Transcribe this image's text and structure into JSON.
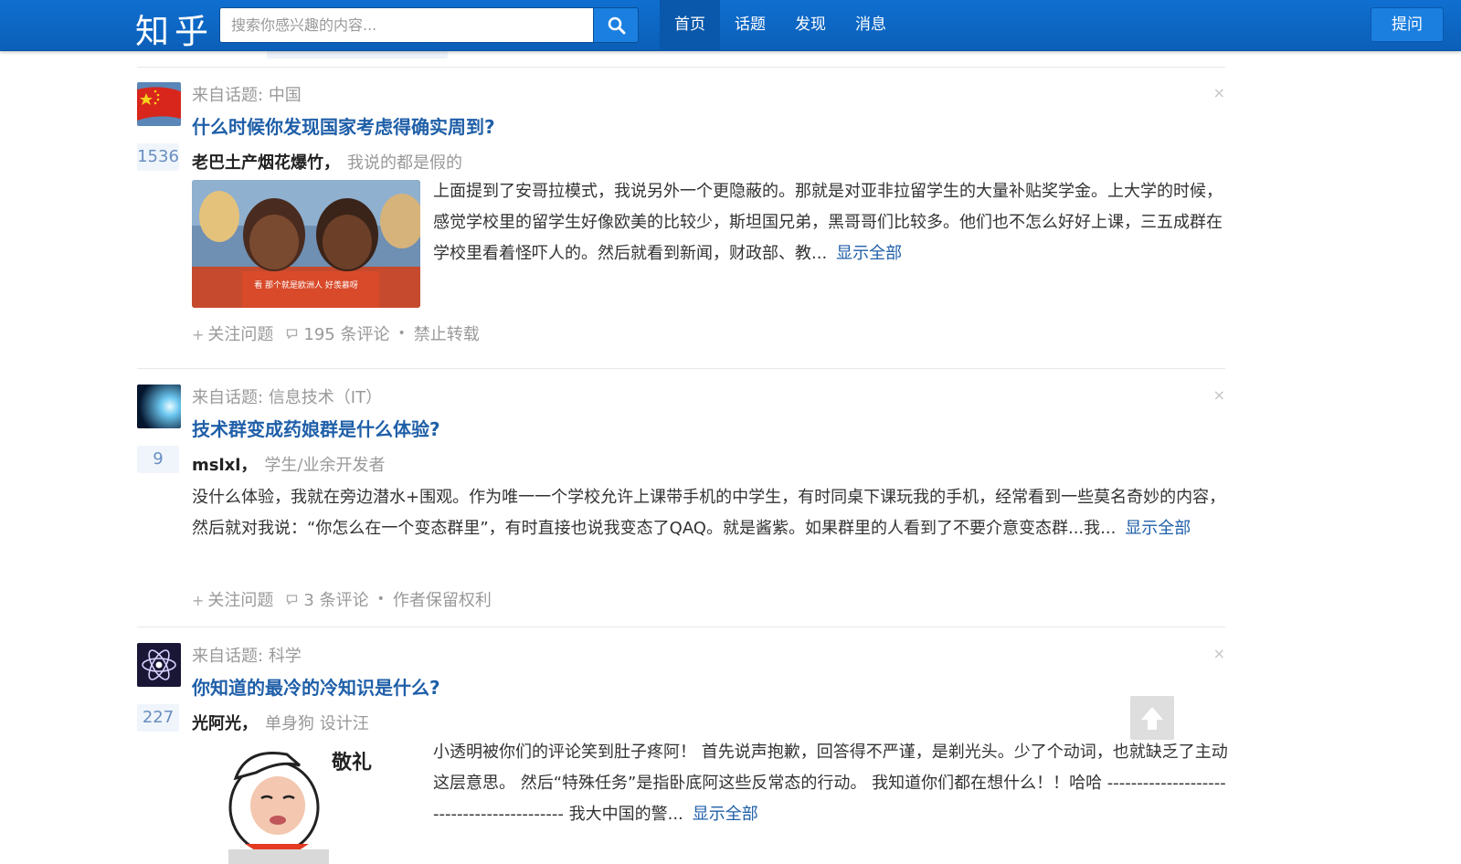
{
  "header": {
    "logo": "知乎",
    "search_placeholder": "搜索你感兴趣的内容...",
    "nav": [
      {
        "label": "首页",
        "active": true
      },
      {
        "label": "话题",
        "active": false
      },
      {
        "label": "发现",
        "active": false
      },
      {
        "label": "消息",
        "active": false
      }
    ],
    "ask_label": "提问",
    "brand_color": "#0f6fd0"
  },
  "feed": [
    {
      "topic_prefix": "来自话题:",
      "topic": "中国",
      "title": "什么时候你发现国家考虑得确实周到?",
      "votes": "1536",
      "author": "老巴土产烟花爆竹，",
      "bio": "我说的都是假的",
      "excerpt": "上面提到了安哥拉模式，我说另外一个更隐蔽的。那就是对亚非拉留学生的大量补贴奖学金。上大学的时候，感觉学校里的留学生好像欧美的比较少，斯坦国兄弟，黑哥哥们比较多。他们也不怎么好好上课，三五成群在学校里看着怪吓人的。然后就看到新闻，财政部、教...",
      "show_all": "显示全部",
      "follow": "关注问题",
      "comments": "195 条评论",
      "rights": "禁止转载",
      "thumb_caption": "看 那个就是欧洲人 好羡慕呀"
    },
    {
      "topic_prefix": "来自话题:",
      "topic": "信息技术（IT）",
      "title": "技术群变成药娘群是什么体验?",
      "votes": "9",
      "author": "mslxl，",
      "bio": "学生/业余开发者",
      "excerpt": "没什么体验，我就在旁边潜水+围观。作为唯一一个学校允许上课带手机的中学生，有时同桌下课玩我的手机，经常看到一些莫名奇妙的内容，然后就对我说：“你怎么在一个变态群里”，有时直接也说我变态了QAQ。就是酱紫。如果群里的人看到了不要介意变态群...我...",
      "show_all": "显示全部",
      "follow": "关注问题",
      "comments": "3 条评论",
      "rights": "作者保留权利"
    },
    {
      "topic_prefix": "来自话题:",
      "topic": "科学",
      "title": "你知道的最冷的冷知识是什么?",
      "votes": "227",
      "author": "光阿光，",
      "bio": "单身狗 设计汪",
      "excerpt": "小透明被你们的评论笑到肚子疼阿！ 首先说声抱歉，回答得不严谨，是剃光头。少了个动词，也就缺乏了主动这层意思。 然后“特殊任务”是指卧底阿这些反常态的行动。 我知道你们都在想什么！！哈哈 ------------------------------------------ 我大中国的警...",
      "show_all": "显示全部",
      "thumb_caption": "敬礼"
    }
  ],
  "close_label": "×"
}
